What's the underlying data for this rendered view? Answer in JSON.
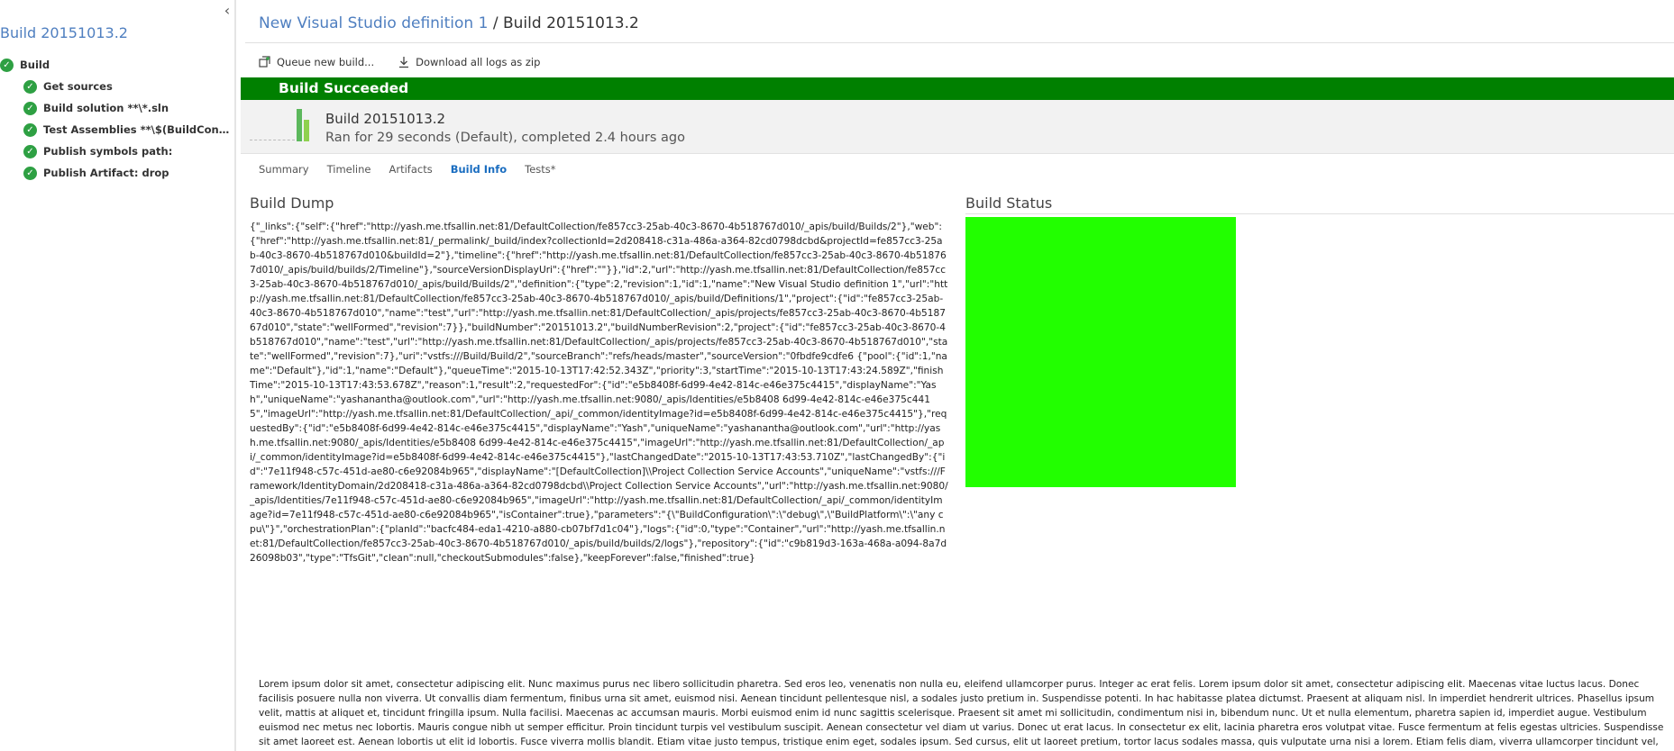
{
  "left_panel": {
    "title": "Build 20151013.2",
    "collapse_glyph": "‹",
    "root": {
      "label": "Build",
      "status": "succeeded"
    },
    "steps": [
      {
        "label": "Get sources"
      },
      {
        "label": "Build solution **\\*.sln"
      },
      {
        "label": "Test Assemblies **\\$(BuildConfigur..."
      },
      {
        "label": "Publish symbols path:"
      },
      {
        "label": "Publish Artifact: drop"
      }
    ]
  },
  "breadcrumb": {
    "definition": "New Visual Studio definition 1",
    "separator": " / ",
    "build": "Build 20151013.2"
  },
  "toolbar": {
    "queue_label": "Queue new build...",
    "download_label": "Download all logs as zip",
    "queue_icon": "queue-build-icon",
    "download_icon": "download-icon"
  },
  "status": {
    "text": "Build Succeeded",
    "color": "#008000"
  },
  "summary": {
    "title": "Build 20151013.2",
    "subtitle": "Ran for 29 seconds (Default), completed 2.4 hours ago"
  },
  "tabs": [
    {
      "label": "Summary",
      "active": false
    },
    {
      "label": "Timeline",
      "active": false
    },
    {
      "label": "Artifacts",
      "active": false
    },
    {
      "label": "Build Info",
      "active": true
    },
    {
      "label": "Tests*",
      "active": false
    }
  ],
  "build_dump": {
    "title": "Build Dump",
    "text": "{\"_links\":{\"self\":{\"href\":\"http://yash.me.tfsallin.net:81/DefaultCollection/fe857cc3-25ab-40c3-8670-4b518767d010/_apis/build/Builds/2\"},\"web\":{\"href\":\"http://yash.me.tfsallin.net:81/_permalink/_build/index?collectionId=2d208418-c31a-486a-a364-82cd0798dcbd&projectId=fe857cc3-25ab-40c3-8670-4b518767d010&buildId=2\"},\"timeline\":{\"href\":\"http://yash.me.tfsallin.net:81/DefaultCollection/fe857cc3-25ab-40c3-8670-4b518767d010/_apis/build/builds/2/Timeline\"},\"sourceVersionDisplayUri\":{\"href\":\"\"}},\"id\":2,\"url\":\"http://yash.me.tfsallin.net:81/DefaultCollection/fe857cc3-25ab-40c3-8670-4b518767d010/_apis/build/Builds/2\",\"definition\":{\"type\":2,\"revision\":1,\"id\":1,\"name\":\"New Visual Studio definition 1\",\"url\":\"http://yash.me.tfsallin.net:81/DefaultCollection/fe857cc3-25ab-40c3-8670-4b518767d010/_apis/build/Definitions/1\",\"project\":{\"id\":\"fe857cc3-25ab-40c3-8670-4b518767d010\",\"name\":\"test\",\"url\":\"http://yash.me.tfsallin.net:81/DefaultCollection/_apis/projects/fe857cc3-25ab-40c3-8670-4b518767d010\",\"state\":\"wellFormed\",\"revision\":7}},\"buildNumber\":\"20151013.2\",\"buildNumberRevision\":2,\"project\":{\"id\":\"fe857cc3-25ab-40c3-8670-4b518767d010\",\"name\":\"test\",\"url\":\"http://yash.me.tfsallin.net:81/DefaultCollection/_apis/projects/fe857cc3-25ab-40c3-8670-4b518767d010\",\"state\":\"wellFormed\",\"revision\":7},\"uri\":\"vstfs:///Build/Build/2\",\"sourceBranch\":\"refs/heads/master\",\"sourceVersion\":\"0fbdfe9cdfe6 {\"pool\":{\"id\":1,\"name\":\"Default\"},\"id\":1,\"name\":\"Default\"},\"queueTime\":\"2015-10-13T17:42:52.343Z\",\"priority\":3,\"startTime\":\"2015-10-13T17:43:24.589Z\",\"finishTime\":\"2015-10-13T17:43:53.678Z\",\"reason\":1,\"result\":2,\"requestedFor\":{\"id\":\"e5b8408f-6d99-4e42-814c-e46e375c4415\",\"displayName\":\"Yash\",\"uniqueName\":\"yashanantha@outlook.com\",\"url\":\"http://yash.me.tfsallin.net:9080/_apis/Identities/e5b8408 6d99-4e42-814c-e46e375c4415\",\"imageUrl\":\"http://yash.me.tfsallin.net:81/DefaultCollection/_api/_common/identityImage?id=e5b8408f-6d99-4e42-814c-e46e375c4415\"},\"requestedBy\":{\"id\":\"e5b8408f-6d99-4e42-814c-e46e375c4415\",\"displayName\":\"Yash\",\"uniqueName\":\"yashanantha@outlook.com\",\"url\":\"http://yash.me.tfsallin.net:9080/_apis/Identities/e5b8408 6d99-4e42-814c-e46e375c4415\",\"imageUrl\":\"http://yash.me.tfsallin.net:81/DefaultCollection/_api/_common/identityImage?id=e5b8408f-6d99-4e42-814c-e46e375c4415\"},\"lastChangedDate\":\"2015-10-13T17:43:53.710Z\",\"lastChangedBy\":{\"id\":\"7e11f948-c57c-451d-ae80-c6e92084b965\",\"displayName\":\"[DefaultCollection]\\\\Project Collection Service Accounts\",\"uniqueName\":\"vstfs:///Framework/IdentityDomain/2d208418-c31a-486a-a364-82cd0798dcbd\\\\Project Collection Service Accounts\",\"url\":\"http://yash.me.tfsallin.net:9080/_apis/Identities/7e11f948-c57c-451d-ae80-c6e92084b965\",\"imageUrl\":\"http://yash.me.tfsallin.net:81/DefaultCollection/_api/_common/identityImage?id=7e11f948-c57c-451d-ae80-c6e92084b965\",\"isContainer\":true},\"parameters\":\"{\\\"BuildConfiguration\\\":\\\"debug\\\",\\\"BuildPlatform\\\":\\\"any cpu\\\"}\",\"orchestrationPlan\":{\"planId\":\"bacfc484-eda1-4210-a880-cb07bf7d1c04\"},\"logs\":{\"id\":0,\"type\":\"Container\",\"url\":\"http://yash.me.tfsallin.net:81/DefaultCollection/fe857cc3-25ab-40c3-8670-4b518767d010/_apis/build/builds/2/logs\"},\"repository\":{\"id\":\"c9b819d3-163a-468a-a094-8a7d26098b03\",\"type\":\"TfsGit\",\"clean\":null,\"checkoutSubmodules\":false},\"keepForever\":false,\"finished\":true}"
  },
  "build_status": {
    "title": "Build Status",
    "color": "#22ff00"
  },
  "lorem": {
    "text": "Lorem ipsum dolor sit amet, consectetur adipiscing elit. Nunc maximus purus nec libero sollicitudin pharetra. Sed eros leo, venenatis non nulla eu, eleifend ullamcorper purus. Integer ac erat felis. Lorem ipsum dolor sit amet, consectetur adipiscing elit. Maecenas vitae luctus lacus. Donec facilisis posuere nulla non viverra. Ut convallis diam fermentum, finibus urna sit amet, euismod nisi. Aenean tincidunt pellentesque nisl, a sodales justo pretium in. Suspendisse potenti. In hac habitasse platea dictumst. Praesent at aliquam nisl. In imperdiet hendrerit ultrices. Phasellus ipsum velit, mattis at aliquet et, tincidunt fringilla ipsum. Nulla facilisi. Maecenas ac accumsan mauris. Morbi euismod enim id nunc sagittis scelerisque. Praesent sit amet mi sollicitudin, condimentum nisi in, bibendum nunc. Ut et nulla elementum, pharetra sapien id, imperdiet augue. Vestibulum euismod nec metus nec lobortis. Mauris congue nibh ut semper efficitur. Proin tincidunt turpis vel vestibulum suscipit. Aenean consectetur vel diam ut varius. Donec ut erat lacus. In consectetur ex elit, lacinia pharetra eros volutpat vitae. Fusce fermentum at felis egestas ultricies. Suspendisse sit amet laoreet est. Aenean lobortis ut elit id lobortis. Fusce viverra mollis blandit. Etiam vitae justo tempus, tristique enim eget, sodales ipsum. Sed cursus, elit ut laoreet pretium, tortor lacus sodales massa, quis vulputate urna nisi a lorem. Etiam felis diam, viverra ullamcorper tincidunt vel, mattis sed odio. Sed"
  }
}
